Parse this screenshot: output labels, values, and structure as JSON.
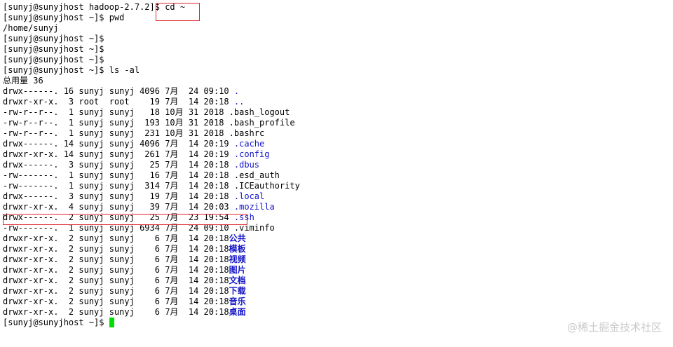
{
  "terminal": {
    "lines": [
      {
        "text": "[sunyj@sunyjhost hadoop-2.7.2]$ cd ~"
      },
      {
        "text": "[sunyj@sunyjhost ~]$ pwd"
      },
      {
        "text": "/home/sunyj"
      },
      {
        "text": "[sunyj@sunyjhost ~]$"
      },
      {
        "text": "[sunyj@sunyjhost ~]$"
      },
      {
        "text": "[sunyj@sunyjhost ~]$"
      },
      {
        "text": "[sunyj@sunyjhost ~]$ ls -al"
      },
      {
        "text": "总用量 36"
      },
      {
        "text": "drwx------. 16 sunyj sunyj 4096 7月  24 09:10 ",
        "name": ".",
        "kind": "dir"
      },
      {
        "text": "drwxr-xr-x.  3 root  root    19 7月  14 20:18 ",
        "name": "..",
        "kind": "dir"
      },
      {
        "text": "-rw-r--r--.  1 sunyj sunyj   18 10月 31 2018 .bash_logout"
      },
      {
        "text": "-rw-r--r--.  1 sunyj sunyj  193 10月 31 2018 .bash_profile"
      },
      {
        "text": "-rw-r--r--.  1 sunyj sunyj  231 10月 31 2018 .bashrc"
      },
      {
        "text": "drwx------. 14 sunyj sunyj 4096 7月  14 20:19 ",
        "name": ".cache",
        "kind": "dir"
      },
      {
        "text": "drwxr-xr-x. 14 sunyj sunyj  261 7月  14 20:19 ",
        "name": ".config",
        "kind": "dir"
      },
      {
        "text": "drwx------.  3 sunyj sunyj   25 7月  14 20:18 ",
        "name": ".dbus",
        "kind": "dir"
      },
      {
        "text": "-rw-------.  1 sunyj sunyj   16 7月  14 20:18 .esd_auth"
      },
      {
        "text": "-rw-------.  1 sunyj sunyj  314 7月  14 20:18 .ICEauthority"
      },
      {
        "text": "drwx------.  3 sunyj sunyj   19 7月  14 20:18 ",
        "name": ".local",
        "kind": "dir"
      },
      {
        "text": "drwxr-xr-x.  4 sunyj sunyj   39 7月  14 20:03 ",
        "name": ".mozilla",
        "kind": "dir"
      },
      {
        "text": "drwx------.  2 sunyj sunyj   25 7月  23 19:54 ",
        "name": ".ssh",
        "kind": "dir"
      },
      {
        "text": "-rw-------.  1 sunyj sunyj 6934 7月  24 09:10 .viminfo"
      },
      {
        "text": "drwxr-xr-x.  2 sunyj sunyj    6 7月  14 20:18",
        "name": "公共",
        "kind": "cjkdir"
      },
      {
        "text": "drwxr-xr-x.  2 sunyj sunyj    6 7月  14 20:18",
        "name": "模板",
        "kind": "cjkdir"
      },
      {
        "text": "drwxr-xr-x.  2 sunyj sunyj    6 7月  14 20:18",
        "name": "视频",
        "kind": "cjkdir"
      },
      {
        "text": "drwxr-xr-x.  2 sunyj sunyj    6 7月  14 20:18",
        "name": "图片",
        "kind": "cjkdir"
      },
      {
        "text": "drwxr-xr-x.  2 sunyj sunyj    6 7月  14 20:18",
        "name": "文档",
        "kind": "cjkdir"
      },
      {
        "text": "drwxr-xr-x.  2 sunyj sunyj    6 7月  14 20:18",
        "name": "下载",
        "kind": "cjkdir"
      },
      {
        "text": "drwxr-xr-x.  2 sunyj sunyj    6 7月  14 20:18",
        "name": "音乐",
        "kind": "cjkdir"
      },
      {
        "text": "drwxr-xr-x.  2 sunyj sunyj    6 7月  14 20:18",
        "name": "桌面",
        "kind": "cjkdir"
      },
      {
        "text": "[sunyj@sunyjhost ~]$ ",
        "cursor": true
      }
    ]
  },
  "watermark": "@稀土掘金技术社区",
  "colors": {
    "directory": "#1414c8",
    "cursor": "#00e000",
    "highlight": "#e0242c",
    "watermark": "#c9c9c9"
  }
}
